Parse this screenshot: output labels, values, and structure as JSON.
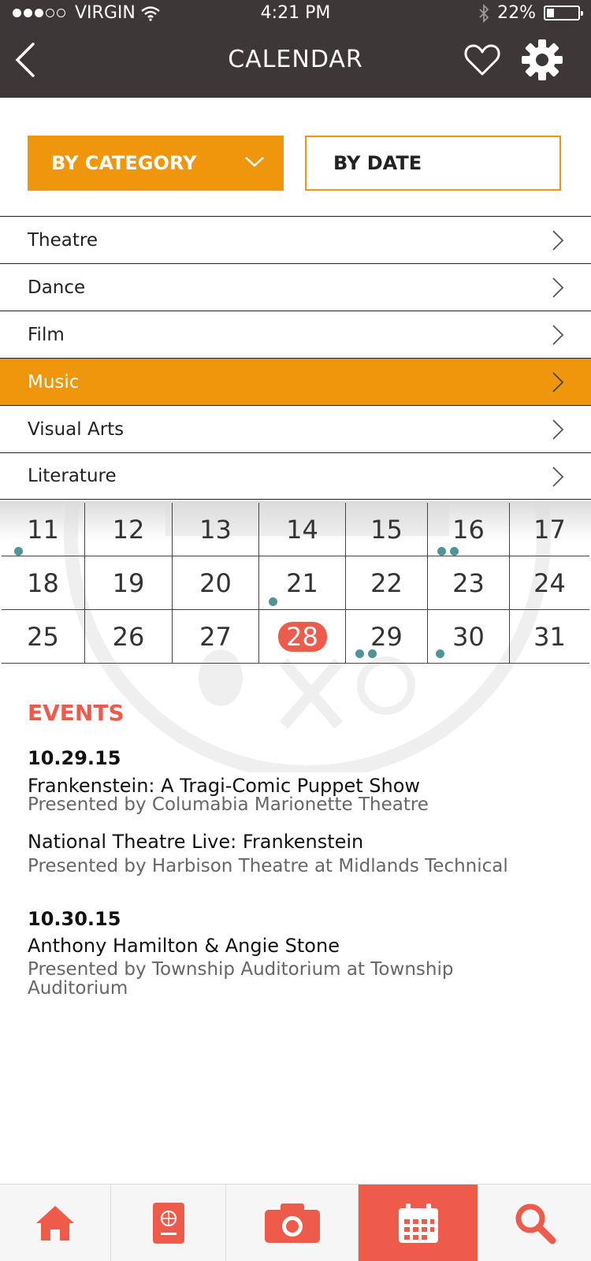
{
  "status": {
    "carrier": "VIRGIN",
    "time": "4:21 PM",
    "battery": "22%"
  },
  "header": {
    "title": "CALENDAR"
  },
  "toggles": {
    "by_category": "BY CATEGORY",
    "by_date": "BY DATE"
  },
  "categories": [
    {
      "label": "Theatre",
      "active": false
    },
    {
      "label": "Dance",
      "active": false
    },
    {
      "label": "Film",
      "active": false
    },
    {
      "label": "Music",
      "active": true
    },
    {
      "label": "Visual Arts",
      "active": false
    },
    {
      "label": "Literature",
      "active": false
    }
  ],
  "calendar": {
    "weeks": [
      [
        "11",
        "12",
        "13",
        "14",
        "15",
        "16",
        "17"
      ],
      [
        "18",
        "19",
        "20",
        "21",
        "22",
        "23",
        "24"
      ],
      [
        "25",
        "26",
        "27",
        "28",
        "29",
        "30",
        "31"
      ]
    ],
    "today": "28",
    "event_dot_color": "#4d9597"
  },
  "events": {
    "title": "EVENTS",
    "groups": [
      {
        "date": "10.29.15",
        "items": [
          {
            "name": "Frankenstein: A Tragi-Comic Puppet Show",
            "presenter": "Presented by Columabia Marionette Theatre"
          },
          {
            "name": "National Theatre Live: Frankenstein",
            "presenter": "Presented by Harbison Theatre at Midlands Technical"
          }
        ]
      },
      {
        "date": "10.30.15",
        "items": [
          {
            "name": "Anthony Hamilton & Angie Stone",
            "presenter": "Presented by Township Auditorium at Township Auditorium"
          }
        ]
      }
    ]
  },
  "tabbar": {
    "tabs": [
      {
        "icon": "home-icon",
        "active": false
      },
      {
        "icon": "passport-icon",
        "active": false
      },
      {
        "icon": "camera-icon",
        "active": false
      },
      {
        "icon": "calendar-icon",
        "active": true
      },
      {
        "icon": "search-icon",
        "active": false
      }
    ]
  },
  "colors": {
    "accent": "#f0960c",
    "brand": "#ee5b4a",
    "header": "#3d3738"
  }
}
